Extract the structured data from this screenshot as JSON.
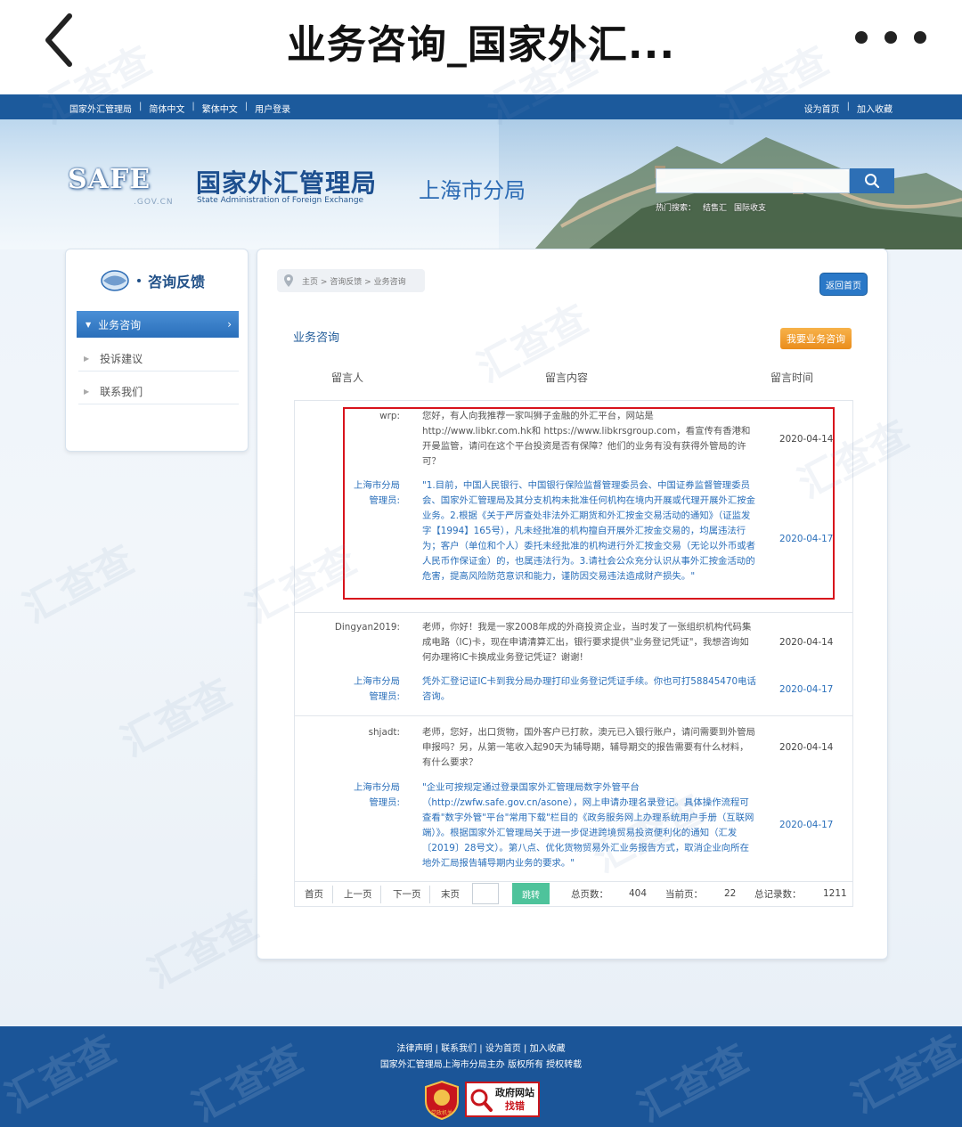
{
  "mobile": {
    "title": "业务咨询_国家外汇..."
  },
  "topbar": {
    "left_links": [
      "国家外汇管理局",
      "简体中文",
      "繁体中文",
      "用户登录"
    ],
    "right_links": [
      "设为首页",
      "加入收藏"
    ]
  },
  "banner": {
    "logo_text": "SAFE",
    "domain": ".GOV.CN",
    "org_name": "国家外汇管理局",
    "org_name_en": "State Administration of Foreign Exchange",
    "branch": "上海市分局",
    "search_placeholder": "",
    "hot_label": "热门搜索：",
    "hot_links": [
      "结售汇",
      "国际收支"
    ]
  },
  "sidebar": {
    "title": "咨询反馈",
    "active_item": "业务咨询",
    "items": [
      "投诉建议",
      "联系我们"
    ]
  },
  "main": {
    "breadcrumb": [
      "主页",
      "咨询反馈",
      "业务咨询"
    ],
    "home_button": "返回首页",
    "section_title": "业务咨询",
    "ask_button": "我要业务咨询",
    "columns": [
      "留言人",
      "留言内容",
      "留言时间"
    ],
    "entries": [
      {
        "user": "wrp:",
        "question": "您好，有人向我推荐一家叫狮子金融的外汇平台，网站是http://www.libkr.com.hk和 https://www.libkrsgroup.com，看宣传有香港和开曼监管，请问在这个平台投资是否有保障？他们的业务有没有获得外管局的许可？",
        "question_time": "2020-04-14",
        "admin": "上海市分局管理员:",
        "answer": "\"1.目前，中国人民银行、中国银行保险监督管理委员会、中国证券监督管理委员会、国家外汇管理局及其分支机构未批准任何机构在境内开展或代理开展外汇按金业务。2.根据《关于严厉查处非法外汇期货和外汇按金交易活动的通知》（证监发字【1994】165号），凡未经批准的机构擅自开展外汇按金交易的，均属违法行为；客户（单位和个人）委托未经批准的机构进行外汇按金交易（无论以外币或者人民币作保证金）的，也属违法行为。3.请社会公众充分认识从事外汇按金活动的危害，提高风险防范意识和能力，谨防因交易违法造成财产损失。\"",
        "answer_time": "2020-04-17"
      },
      {
        "user": "Dingyan2019:",
        "question": "老师，你好！我是一家2008年成的外商投资企业，当时发了一张组织机构代码集成电路（IC)卡，现在申请清算汇出，银行要求提供\"业务登记凭证\"，我想咨询如何办理将IC卡换成业务登记凭证？谢谢!",
        "question_time": "2020-04-14",
        "admin": "上海市分局管理员:",
        "answer": "凭外汇登记证IC卡到我分局办理打印业务登记凭证手续。你也可打58845470电话咨询。",
        "answer_time": "2020-04-17"
      },
      {
        "user": "shjadt:",
        "question": "老师，您好，出口货物，国外客户已打款，澳元已入银行账户，请问需要到外管局申报吗？另，从第一笔收入起90天为辅导期，辅导期交的报告需要有什么材料，有什么要求？",
        "question_time": "2020-04-14",
        "admin": "上海市分局管理员:",
        "answer": "\"企业可按规定通过登录国家外汇管理局数字外管平台（http://zwfw.safe.gov.cn/asone），网上申请办理名录登记。具体操作流程可查看\"数字外管\"平台\"常用下载\"栏目的《政务服务网上办理系统用户手册（互联网端）》。根据国家外汇管理局关于进一步促进跨境贸易投资便利化的通知（汇发〔2019〕28号文）。第八点、优化货物贸易外汇业务报告方式，取消企业向所在地外汇局报告辅导期内业务的要求。\"",
        "answer_time": "2020-04-17"
      }
    ],
    "pager": {
      "first": "首页",
      "prev": "上一页",
      "next": "下一页",
      "last": "末页",
      "go": "跳转",
      "total_pages_label": "总页数：",
      "total_pages": "404",
      "current_label": "当前页：",
      "current": "22",
      "total_records_label": "总记录数：",
      "total_records": "1211"
    }
  },
  "footer": {
    "links": [
      "法律声明",
      "联系我们",
      "设为首页",
      "加入收藏"
    ],
    "copyright": "国家外汇管理局上海市分局主办 版权所有 授权转载",
    "party_badge": "党政机关",
    "gov_badge_1": "政府网站",
    "gov_badge_2": "找错"
  },
  "watermark": "汇查查",
  "colors": {
    "topbar": "#1c5a9c",
    "footer": "#1b5598",
    "link_blue": "#2a6fba",
    "highlight": "#d8131c",
    "ask_orange": "#ea8d1c",
    "go_green": "#4ec39b"
  }
}
